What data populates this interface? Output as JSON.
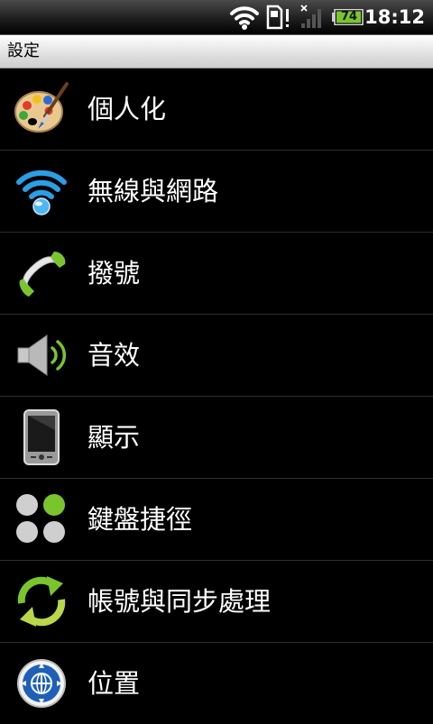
{
  "status_bar": {
    "time": "18:12",
    "battery_level": "74",
    "icons": [
      "wifi-icon",
      "sd-card-alert-icon",
      "no-signal-icon",
      "battery-icon"
    ],
    "battery_color": "#7ac52e"
  },
  "title_bar": {
    "title": "設定"
  },
  "settings": {
    "items": [
      {
        "label": "個人化",
        "icon": "palette-icon"
      },
      {
        "label": "無線與網路",
        "icon": "wifi-icon"
      },
      {
        "label": "撥號",
        "icon": "phone-handset-icon"
      },
      {
        "label": "音效",
        "icon": "speaker-icon"
      },
      {
        "label": "顯示",
        "icon": "phone-display-icon"
      },
      {
        "label": "鍵盤捷徑",
        "icon": "keyboard-shortcut-icon"
      },
      {
        "label": "帳號與同步處理",
        "icon": "sync-icon"
      },
      {
        "label": "位置",
        "icon": "location-compass-icon"
      }
    ]
  },
  "colors": {
    "accent_green": "#7ac52e",
    "wifi_blue": "#2a9fe6",
    "background": "#000000",
    "divider": "#2e2e2e"
  }
}
